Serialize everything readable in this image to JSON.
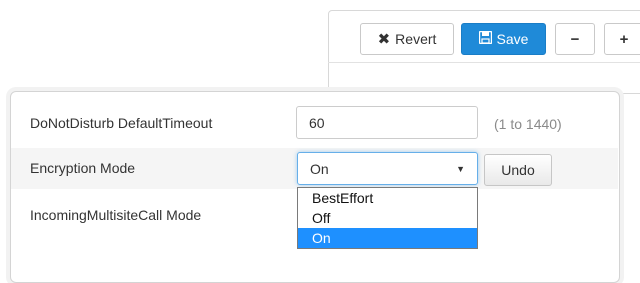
{
  "toolbar": {
    "revert_label": "Revert",
    "save_label": "Save",
    "minus_label": "−",
    "plus_label": "+"
  },
  "settings": {
    "dnd_timeout": {
      "label": "DoNotDisturb DefaultTimeout",
      "value": "60",
      "range": "(1 to 1440)"
    },
    "encryption": {
      "label": "Encryption Mode",
      "selected": "On",
      "undo_label": "Undo",
      "options": [
        "BestEffort",
        "Off",
        "On"
      ]
    },
    "incoming_multisite": {
      "label": "IncomingMultisiteCall Mode"
    }
  },
  "colors": {
    "primary": "#1f8ad8",
    "selected_option": "#1e90ff",
    "focus_border": "#66afe9"
  },
  "icons": {
    "revert": "close-icon",
    "save": "floppy-disk-icon",
    "dropdown": "chevron-down-icon"
  }
}
